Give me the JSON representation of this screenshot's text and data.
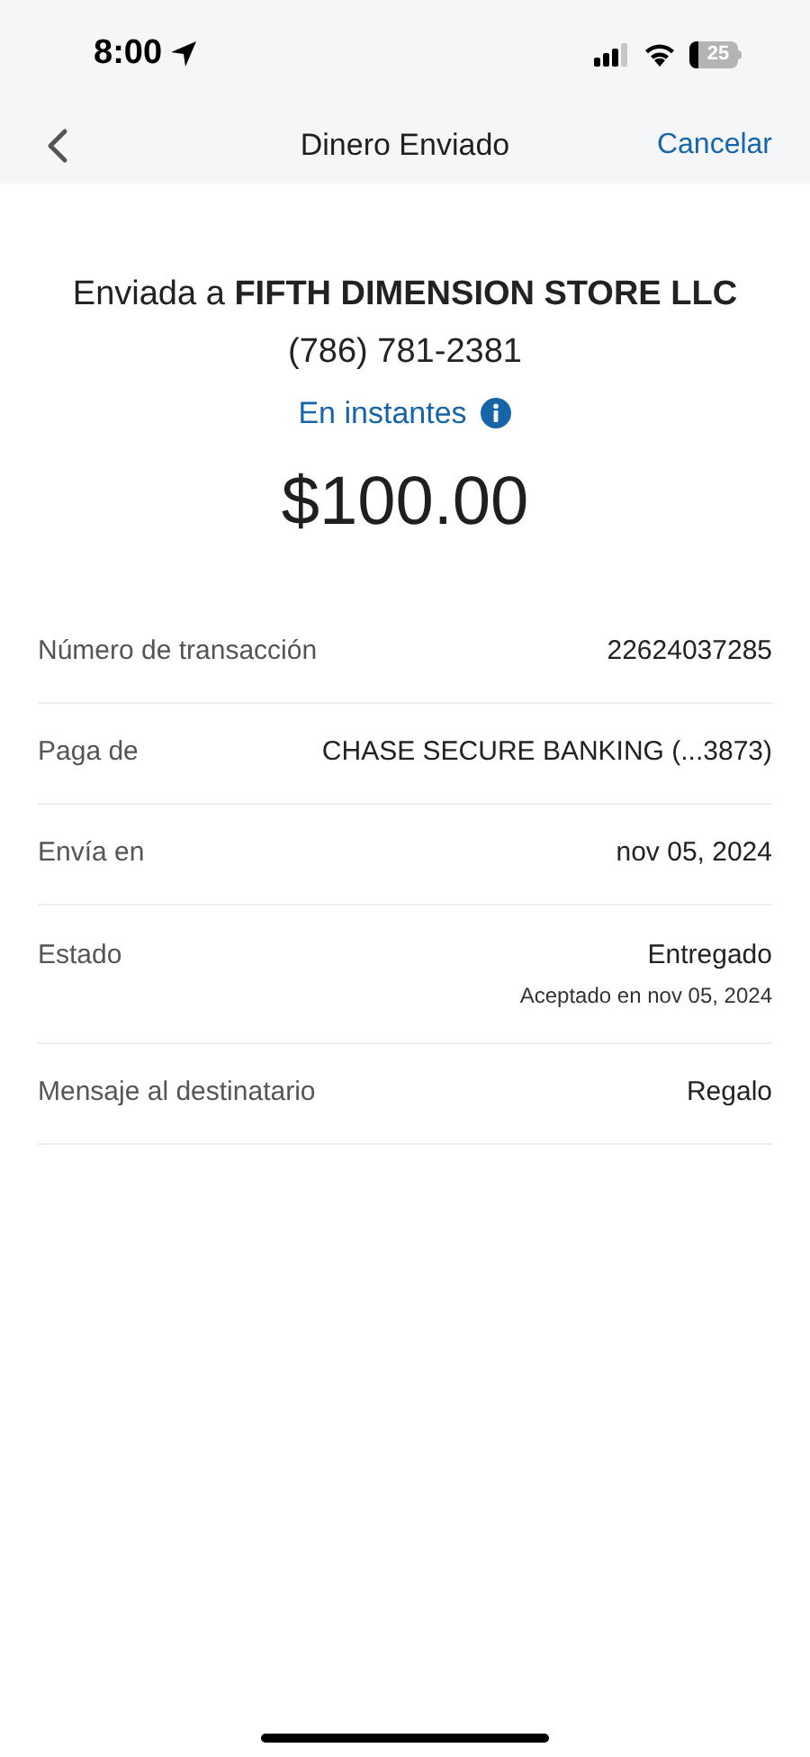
{
  "status_bar": {
    "time": "8:00",
    "battery": "25"
  },
  "nav": {
    "title": "Dinero Enviado",
    "action": "Cancelar"
  },
  "summary": {
    "recipient": "Enviada a **FIFTH DIMENSION STORE LLC**",
    "phone": "(786) 781-2381",
    "speed": "En instantes",
    "amount": "$100.00"
  },
  "details": [
    {
      "label": "Número de transacción",
      "value": "22624037285"
    },
    {
      "label": "Paga de",
      "value": "CHASE SECURE BANKING (...3873)"
    },
    {
      "label": "Envía en",
      "value": "nov 05, 2024"
    },
    {
      "label": "Estado",
      "value": "Entregado",
      "note": "Aceptado en nov 05, 2024"
    },
    {
      "label": "Mensaje al destinatario",
      "value": "Regalo"
    }
  ]
}
